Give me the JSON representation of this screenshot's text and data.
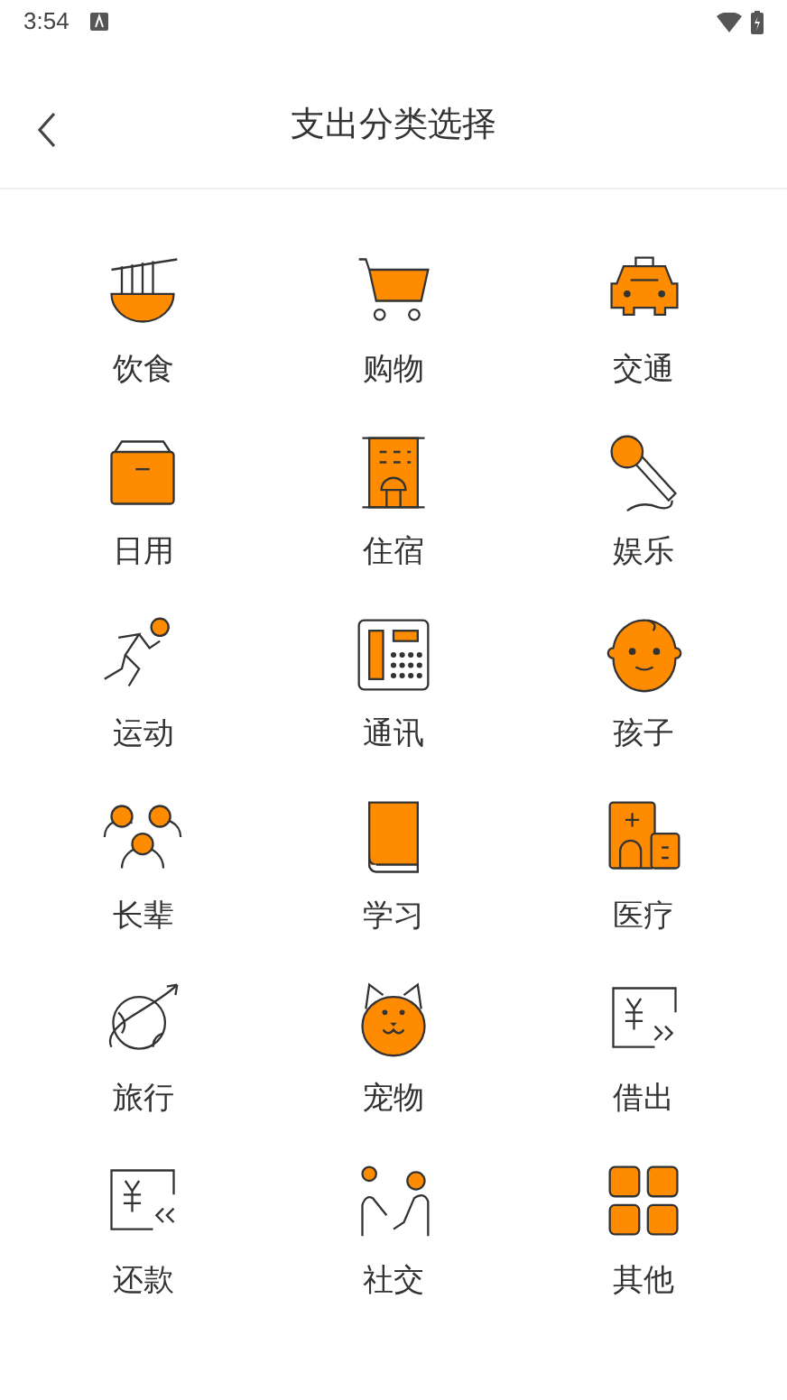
{
  "status_bar": {
    "time": "3:54"
  },
  "header": {
    "title": "支出分类选择"
  },
  "categories": [
    {
      "label": "饮食"
    },
    {
      "label": "购物"
    },
    {
      "label": "交通"
    },
    {
      "label": "日用"
    },
    {
      "label": "住宿"
    },
    {
      "label": "娱乐"
    },
    {
      "label": "运动"
    },
    {
      "label": "通讯"
    },
    {
      "label": "孩子"
    },
    {
      "label": "长辈"
    },
    {
      "label": "学习"
    },
    {
      "label": "医疗"
    },
    {
      "label": "旅行"
    },
    {
      "label": "宠物"
    },
    {
      "label": "借出"
    },
    {
      "label": "还款"
    },
    {
      "label": "社交"
    },
    {
      "label": "其他"
    }
  ]
}
